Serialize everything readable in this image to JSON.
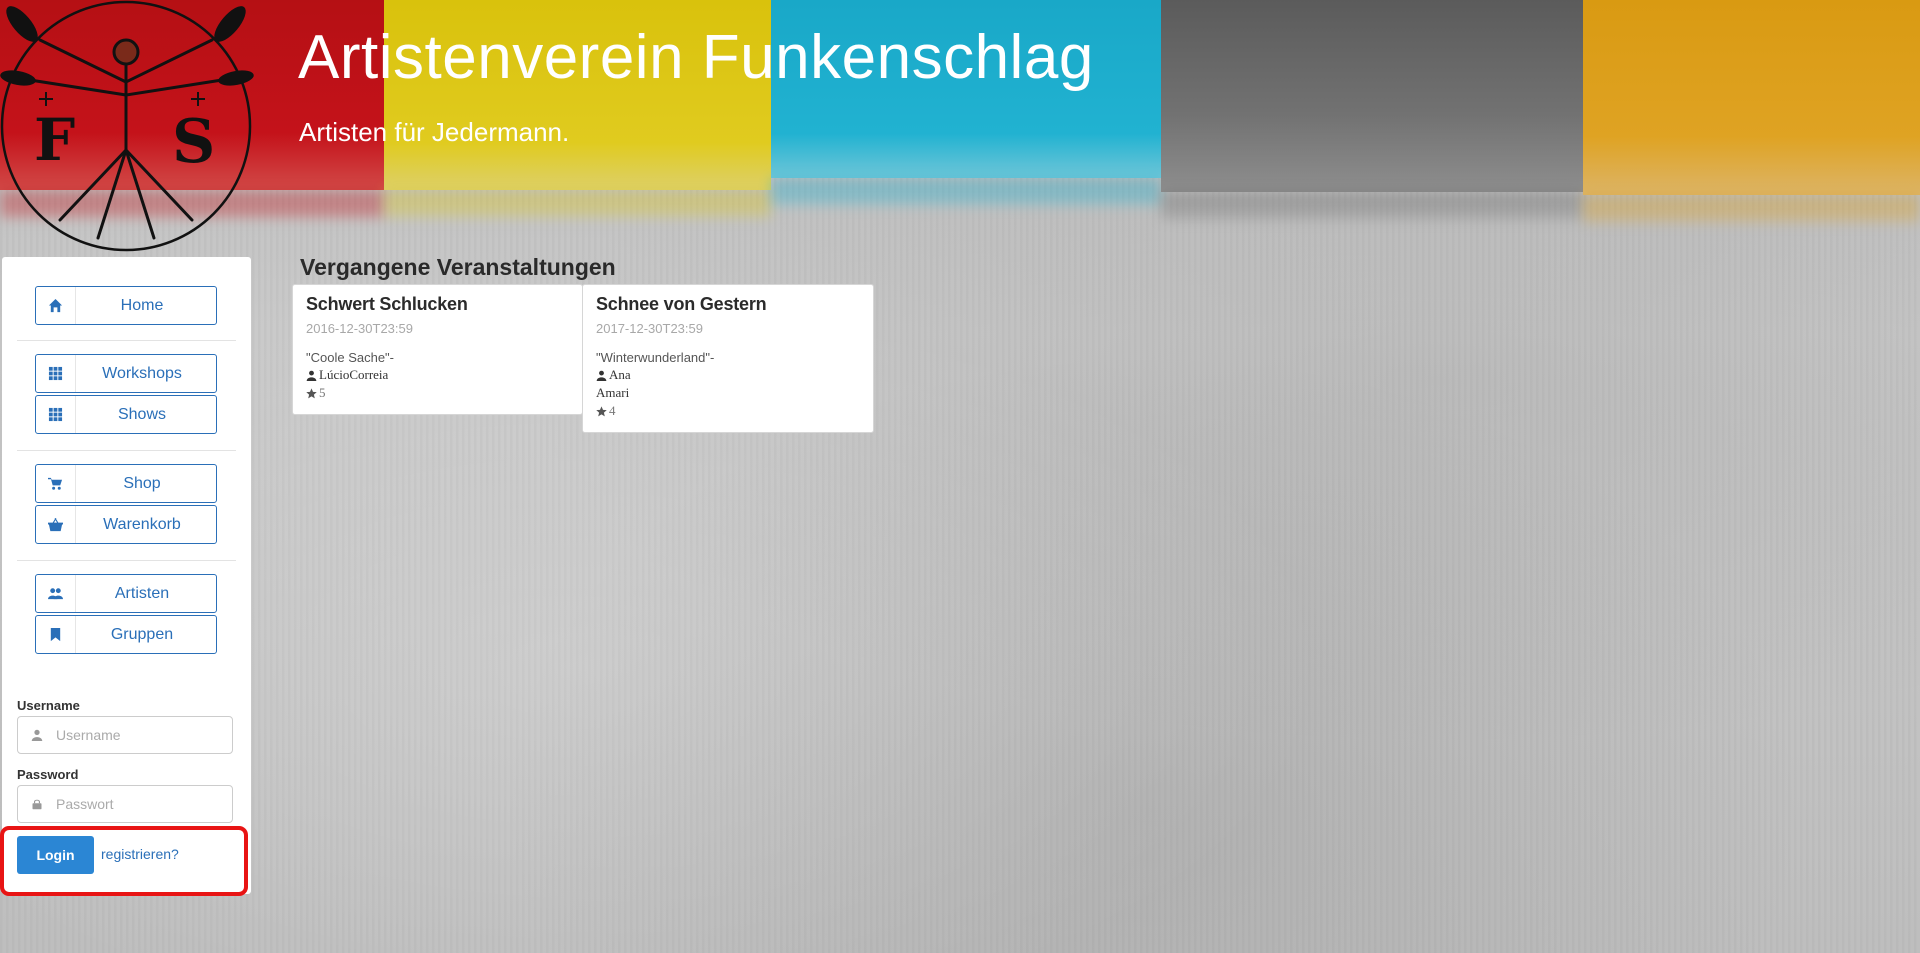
{
  "header": {
    "title": "Artistenverein Funkenschlag",
    "subtitle": "Artisten für Jedermann."
  },
  "colors": {
    "red": "#c4121a",
    "yellow": "#e0cb1f",
    "cyan": "#21b2d1",
    "dark": "#6b6b6b",
    "orange": "#dfa323",
    "accent": "#2a6fb8",
    "login": "#2b86d4",
    "highlight": "#e81414"
  },
  "sidebar": {
    "items": [
      {
        "label": "Home",
        "icon": "home-icon"
      },
      {
        "label": "Workshops",
        "icon": "grid-icon"
      },
      {
        "label": "Shows",
        "icon": "grid-icon"
      },
      {
        "label": "Shop",
        "icon": "cart-icon"
      },
      {
        "label": "Warenkorb",
        "icon": "basket-icon"
      },
      {
        "label": "Artisten",
        "icon": "users-icon"
      },
      {
        "label": "Gruppen",
        "icon": "bookmark-icon"
      }
    ]
  },
  "login": {
    "username_label": "Username",
    "username_placeholder": "Username",
    "password_label": "Password",
    "password_placeholder": "Passwort",
    "login_button": "Login",
    "register_link": "registrieren?"
  },
  "main": {
    "section_title": "Vergangene Veranstaltungen",
    "events": [
      {
        "title": "Schwert Schlucken",
        "date": "2016-12-30T23:59",
        "quote": "\"Coole Sache\"-",
        "artist": "LúcioCorreia",
        "artist_line2": "",
        "rating": "5"
      },
      {
        "title": "Schnee von Gestern",
        "date": "2017-12-30T23:59",
        "quote": "\"Winterwunderland\"-",
        "artist": "Ana",
        "artist_line2": "Amari",
        "rating": "4"
      }
    ]
  }
}
